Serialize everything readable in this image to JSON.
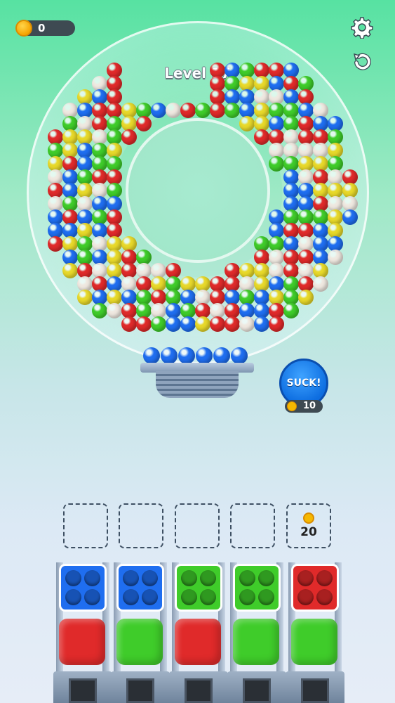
{
  "hud": {
    "coins": "0",
    "level": "Level 17"
  },
  "icons": {
    "settings": "gear-icon",
    "restart": "restart-icon",
    "coin": "coin-icon"
  },
  "suck_button": {
    "label": "SUCK!",
    "cost": "10"
  },
  "locked_slot": {
    "cost": "20"
  },
  "colors": {
    "blue": "#1f6ef0",
    "green": "#3fcc2a",
    "red": "#e02a2a",
    "yellow": "#e8d92a",
    "white": "#efe8e0"
  },
  "columns": [
    {
      "tray": "blue",
      "box": "red"
    },
    {
      "tray": "blue",
      "box": "green"
    },
    {
      "tray": "green",
      "box": "red"
    },
    {
      "tray": "green",
      "box": "green"
    },
    {
      "tray": "red",
      "box": "green"
    }
  ]
}
